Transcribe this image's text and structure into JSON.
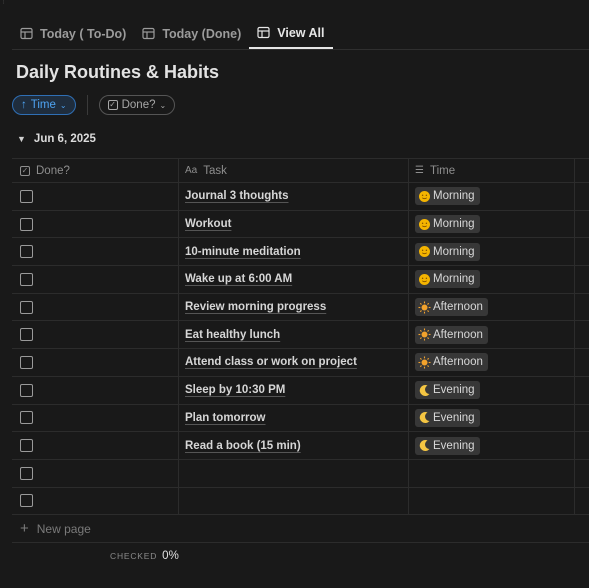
{
  "tabs": [
    {
      "label": "Today ( To-Do)",
      "active": false
    },
    {
      "label": "Today (Done)",
      "active": false
    },
    {
      "label": "View All",
      "active": true
    }
  ],
  "title": "Daily Routines & Habits",
  "filters": {
    "sort_label": "Time",
    "filter_label": "Done?"
  },
  "group": {
    "label": "Jun 6, 2025"
  },
  "columns": {
    "done": "Done?",
    "task": "Task",
    "time": "Time"
  },
  "rows": [
    {
      "task": "Journal 3 thoughts",
      "time": "Morning",
      "icon": "sun-face-icon",
      "done": false
    },
    {
      "task": "Workout",
      "time": "Morning",
      "icon": "sun-face-icon",
      "done": false
    },
    {
      "task": "10-minute meditation",
      "time": "Morning",
      "icon": "sun-face-icon",
      "done": false
    },
    {
      "task": "Wake up at 6:00 AM",
      "time": "Morning",
      "icon": "sun-face-icon",
      "done": false
    },
    {
      "task": "Review morning progress",
      "time": "Afternoon",
      "icon": "sun-icon",
      "done": false
    },
    {
      "task": "Eat healthy lunch",
      "time": "Afternoon",
      "icon": "sun-icon",
      "done": false
    },
    {
      "task": "Attend class or work on project",
      "time": "Afternoon",
      "icon": "sun-icon",
      "done": false
    },
    {
      "task": "Sleep by 10:30 PM",
      "time": "Evening",
      "icon": "crescent-moon-icon",
      "done": false
    },
    {
      "task": "Plan tomorrow",
      "time": "Evening",
      "icon": "crescent-moon-icon",
      "done": false
    },
    {
      "task": "Read a book (15 min)",
      "time": "Evening",
      "icon": "crescent-moon-icon",
      "done": false
    },
    {
      "task": "",
      "time": "",
      "icon": "",
      "done": false
    },
    {
      "task": "",
      "time": "",
      "icon": "",
      "done": false
    }
  ],
  "new_page_label": "New page",
  "calculation": {
    "label": "CHECKED",
    "value": "0%"
  },
  "colors": {
    "background": "#191919",
    "accent": "#4ea3f1",
    "tag_bg": "#373737"
  }
}
